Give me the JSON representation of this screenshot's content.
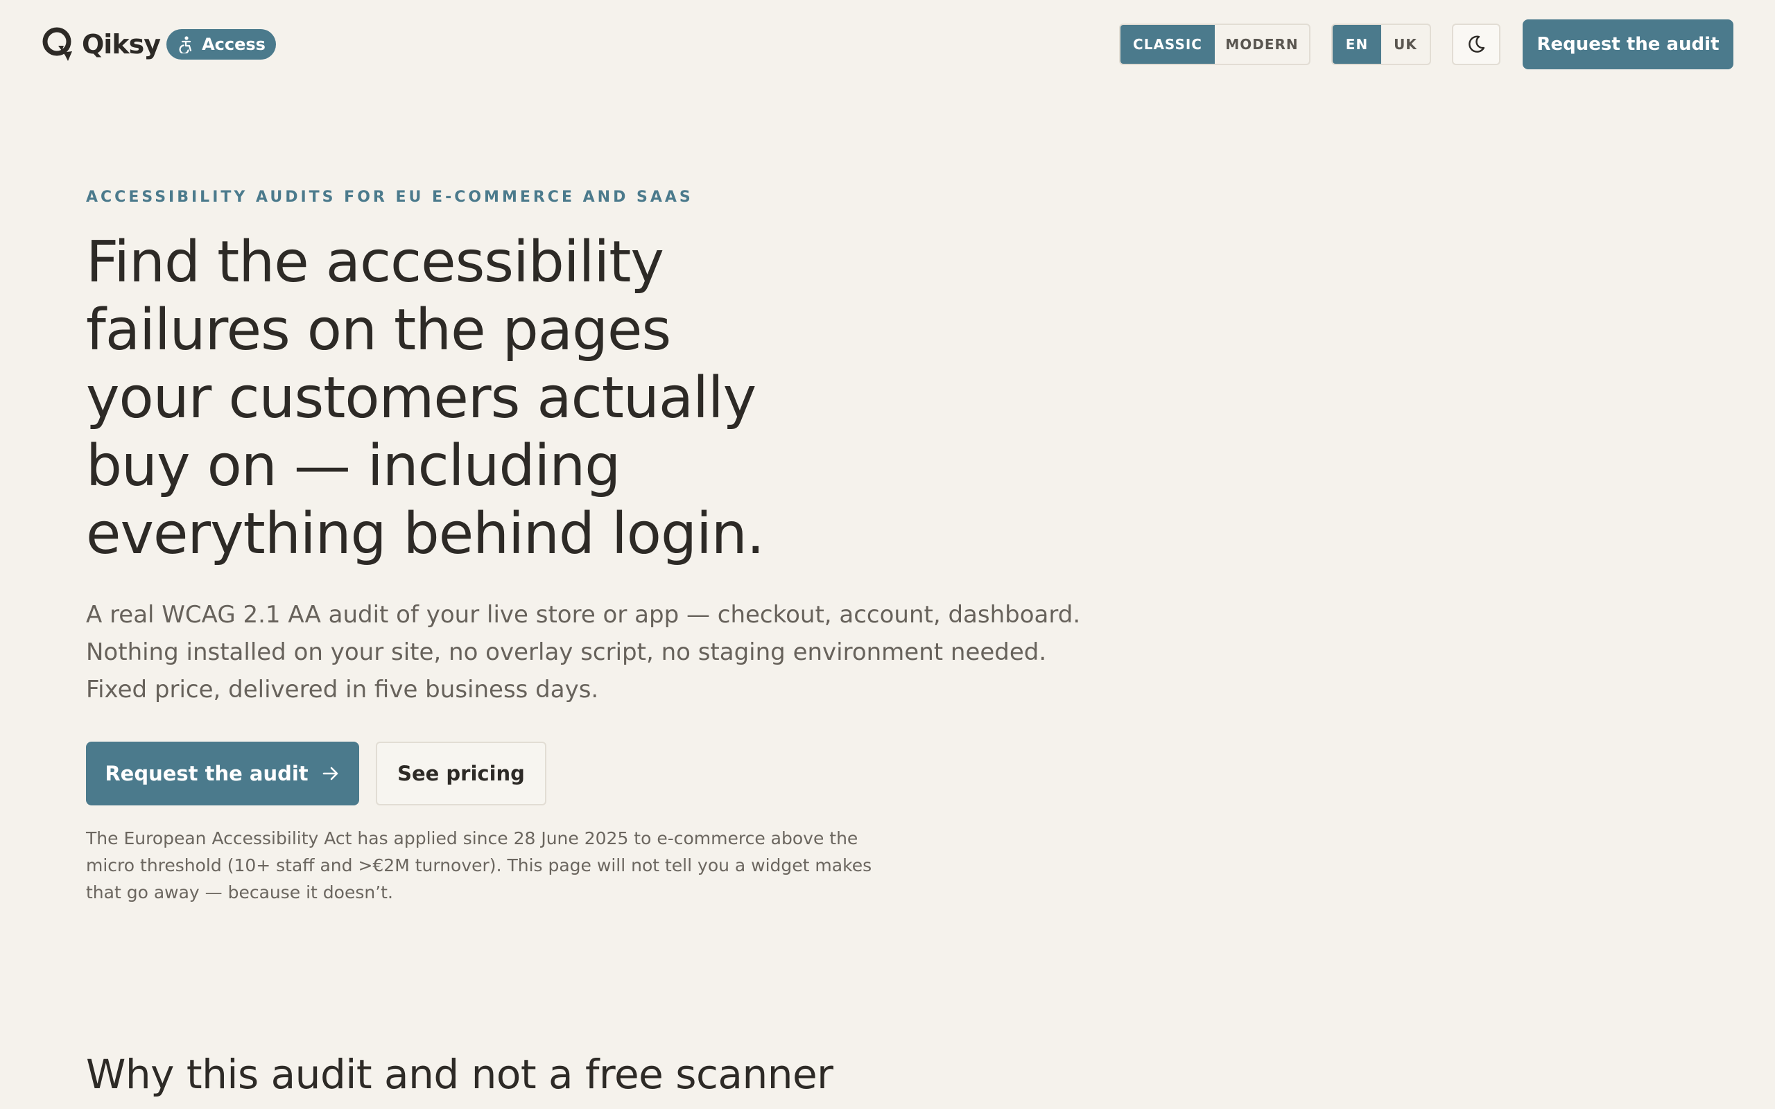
{
  "brand": {
    "name": "Qiksy",
    "logo_icon": "q-logo-icon",
    "access_badge": "Access",
    "access_icon": "accessibility-icon"
  },
  "header": {
    "style_switch": {
      "options": [
        "CLASSIC",
        "MODERN"
      ],
      "selected": "CLASSIC"
    },
    "language_switch": {
      "options": [
        "EN",
        "UK"
      ],
      "selected": "EN"
    },
    "dark_mode_icon": "moon-icon",
    "cta_label": "Request the audit"
  },
  "hero": {
    "eyebrow": "ACCESSIBILITY AUDITS FOR EU E-COMMERCE AND SAAS",
    "title_lines": [
      "Find the accessibility",
      "failures on the pages",
      "your customers actually",
      "buy on — including",
      "everything behind login."
    ],
    "subtitle_lines": [
      "A real WCAG 2.1 AA audit of your live store or app — checkout, account, dashboard.",
      "Nothing installed on your site, no overlay script, no staging environment needed.",
      "Fixed price, delivered in five business days."
    ],
    "primary_cta": "Request the audit",
    "primary_cta_icon": "arrow-right-icon",
    "secondary_cta": "See pricing",
    "note_lines": [
      "The European Accessibility Act has applied since 28 June 2025 to e-commerce above the",
      "micro threshold (10+ staff and >€2M turnover). This page will not tell you a widget makes",
      "that go away — because it doesn’t."
    ]
  },
  "section": {
    "title": "Why this audit and not a free scanner"
  },
  "colors": {
    "background": "#f5f2ec",
    "accent": "#4b7a8c",
    "text": "#2d2a26",
    "muted_text": "#67625b"
  }
}
